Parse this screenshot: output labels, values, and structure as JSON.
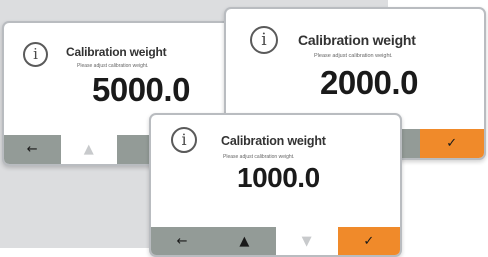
{
  "screens": [
    {
      "title": "Calibration weight",
      "subtitle": "Please adjust calibration weight.",
      "value": "5000.0",
      "buttons": [
        "←",
        "▲",
        "",
        ""
      ]
    },
    {
      "title": "Calibration weight",
      "subtitle": "Please adjust calibration weight.",
      "value": "2000.0",
      "buttons": [
        "",
        "",
        "",
        "✓"
      ]
    },
    {
      "title": "Calibration weight",
      "subtitle": "Please adjust calibration weight.",
      "value": "1000.0",
      "buttons": [
        "←",
        "▲",
        "▼",
        "✓"
      ]
    }
  ],
  "info_icon_glyph": "i",
  "colors": {
    "background_panel": "#dcdddf",
    "button_gray": "#939b97",
    "button_confirm": "#f08a2a",
    "screen_border": "#b9bcc0"
  },
  "icons": [
    "info-icon",
    "arrow-left-icon",
    "arrow-up-icon",
    "arrow-down-icon",
    "checkmark-icon"
  ]
}
